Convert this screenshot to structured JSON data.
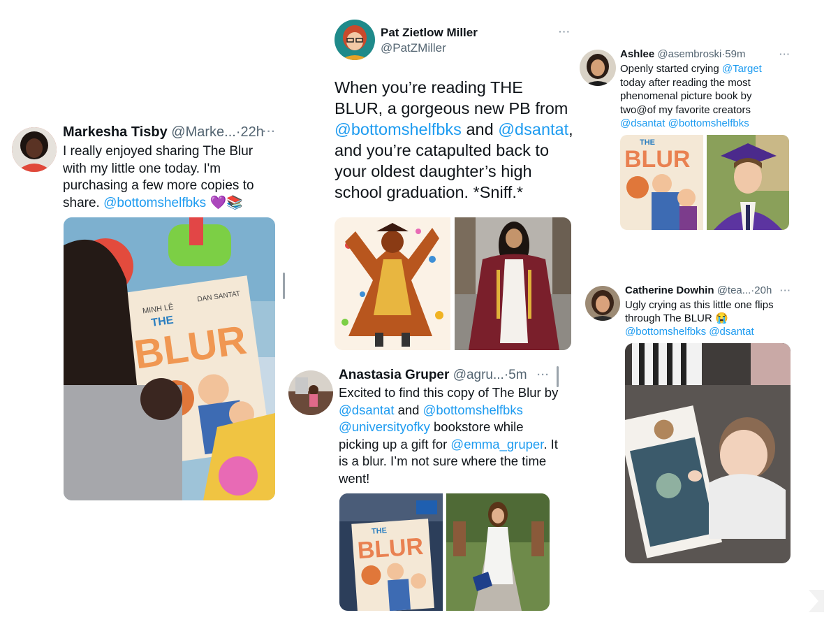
{
  "tweets": {
    "markesha": {
      "name": "Markesha Tisby",
      "handle": "@Marke...",
      "time": "22h",
      "text1": "I really enjoyed sharing The Blur with my little one today. I'm purchasing a few more copies to share.",
      "mention1": "@bottomshelfbks",
      "emoji": "💜📚"
    },
    "pat": {
      "name": "Pat Zietlow Miller",
      "handle": "@PatZMiller",
      "text1": "When you’re reading THE BLUR, a gorgeous new PB from",
      "mention1": "@bottomshelfbks",
      "text2": "and",
      "mention2": "@dsantat",
      "text3": ", and you’re catapulted back to your oldest daughter’s high school graduation. *Sniff.*"
    },
    "ashlee": {
      "name": "Ashlee",
      "handle": "@asembroski",
      "time": "59m",
      "text1": "Openly started crying",
      "mention1": "@Target",
      "text2": "today after reading the most phenomenal picture book by two@of my favorite creators",
      "mention2": "@dsantat",
      "mention3": "@bottomshelfbks"
    },
    "catherine": {
      "name": "Catherine Dowhin",
      "handle": "@tea...",
      "time": "20h",
      "text1": "Ugly crying as this little one flips through The BLUR",
      "emoji": "😭",
      "mention1": "@bottomshelfbks",
      "mention2": "@dsantat"
    },
    "anastasia": {
      "name": "Anastasia Gruper",
      "handle": "@agru...",
      "time": "5m",
      "text1": "Excited to find this copy of The Blur by",
      "mention1": "@dsantat",
      "text2": "and",
      "mention2": "@bottomshelfbks",
      "mention3": "@universityofky",
      "text3": "bookstore while picking up a gift for",
      "mention4": "@emma_gruper",
      "text4": ". It is a blur. I’m not sure where the time went!"
    }
  },
  "book": {
    "title_small": "THE",
    "title_big": "BLUR",
    "author": "MINH LÊ",
    "illustrator": "DAN SANTAT"
  },
  "ui": {
    "dot": "·",
    "more": "···"
  },
  "colors": {
    "mention": "#1d9bf0",
    "handle": "#536471",
    "gown_maroon": "#7a1f2b",
    "cap_purple": "#4b2a8c"
  }
}
